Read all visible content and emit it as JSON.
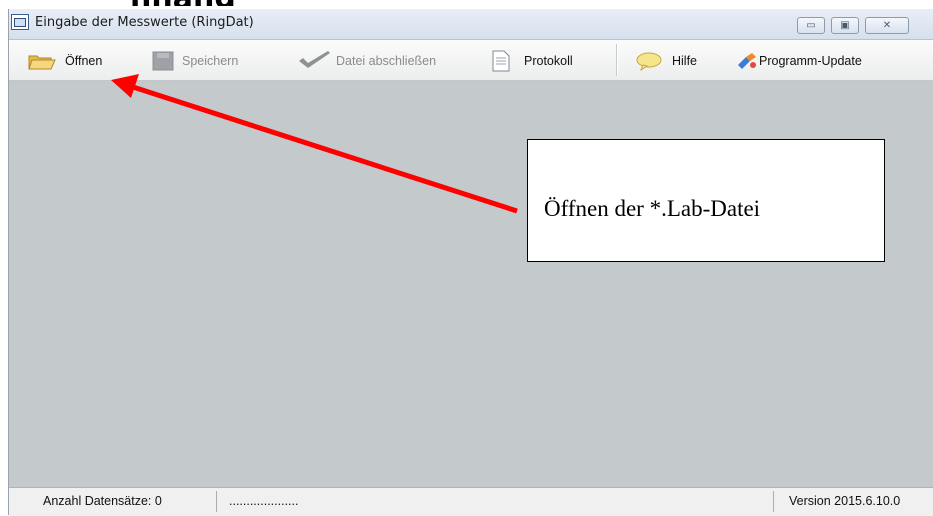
{
  "window": {
    "title": "Eingabe der Messwerte (RingDat)",
    "controls": {
      "minimize": "▭",
      "maximize": "▣",
      "close": "✕"
    }
  },
  "toolbar": {
    "items": [
      {
        "label": "Öffnen",
        "icon": "folder-open-icon",
        "enabled": true
      },
      {
        "label": "Speichern",
        "icon": "save-icon",
        "enabled": false
      },
      {
        "label": "Datei abschließen",
        "icon": "checkmark-icon",
        "enabled": false
      },
      {
        "label": "Protokoll",
        "icon": "document-icon",
        "enabled": true
      },
      {
        "label": "Hilfe",
        "icon": "speech-bubble-icon",
        "enabled": true
      },
      {
        "label": "Programm-Update",
        "icon": "update-icon",
        "enabled": true
      }
    ]
  },
  "statusbar": {
    "records": "Anzahl Datensätze: 0",
    "placeholder": "....................",
    "version": "Version 2015.6.10.0"
  },
  "annotation": {
    "callout_text": "Öffnen der *.Lab-Datei",
    "arrow_color": "#ff0000"
  },
  "clipped_heading": "nhang"
}
